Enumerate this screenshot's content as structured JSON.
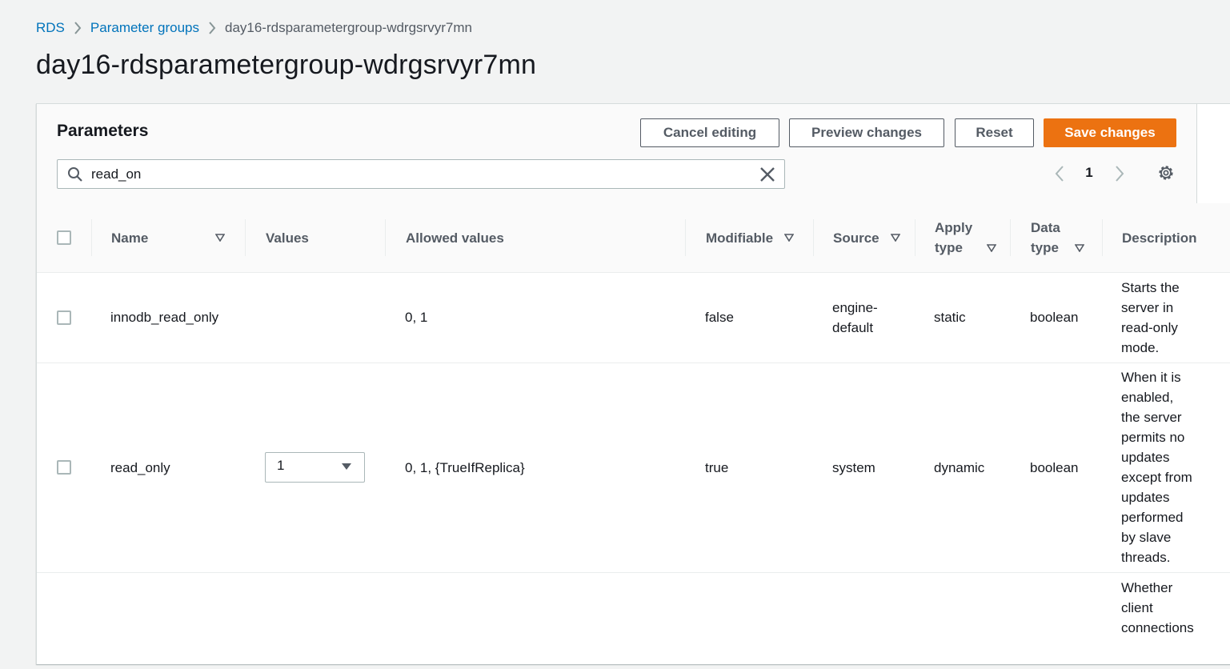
{
  "breadcrumb": {
    "items": [
      "RDS",
      "Parameter groups",
      "day16-rdsparametergroup-wdrgsrvyr7mn"
    ]
  },
  "page_title": "day16-rdsparametergroup-wdrgsrvyr7mn",
  "parameters": {
    "title": "Parameters",
    "buttons": {
      "cancel": "Cancel editing",
      "preview": "Preview changes",
      "reset": "Reset",
      "save": "Save changes"
    },
    "search": {
      "value": "read_on",
      "icon": "search-icon",
      "clear_icon": "close-icon"
    },
    "pagination": {
      "current_page": "1",
      "prev_icon": "chevron-left-icon",
      "next_icon": "chevron-right-icon"
    },
    "settings_icon": "gear-icon",
    "accent_color": "#ec7211",
    "link_color": "#0073bb"
  },
  "table": {
    "columns": {
      "name": "Name",
      "values": "Values",
      "allowed_values": "Allowed values",
      "modifiable": "Modifiable",
      "source": "Source",
      "apply_type_1": "Apply",
      "apply_type_2": "type",
      "data_type_1": "Data",
      "data_type_2": "type",
      "description": "Description"
    },
    "rows": [
      {
        "name": "innodb_read_only",
        "value": "",
        "allowed_values": "0, 1",
        "modifiable": "false",
        "source_1": "engine-",
        "source_2": "default",
        "apply_type": "static",
        "data_type": "boolean",
        "description": [
          "Starts the",
          "server in",
          "read-only",
          "mode."
        ]
      },
      {
        "name": "read_only",
        "value": "1",
        "allowed_values": "0, 1, {TrueIfReplica}",
        "modifiable": "true",
        "source": "system",
        "apply_type": "dynamic",
        "data_type": "boolean",
        "description": [
          "When it is",
          "enabled,",
          "the server",
          "permits no",
          "updates",
          "except from",
          "updates",
          "performed",
          "by slave",
          "threads."
        ]
      },
      {
        "description": [
          "Whether",
          "client",
          "connections"
        ]
      }
    ]
  }
}
